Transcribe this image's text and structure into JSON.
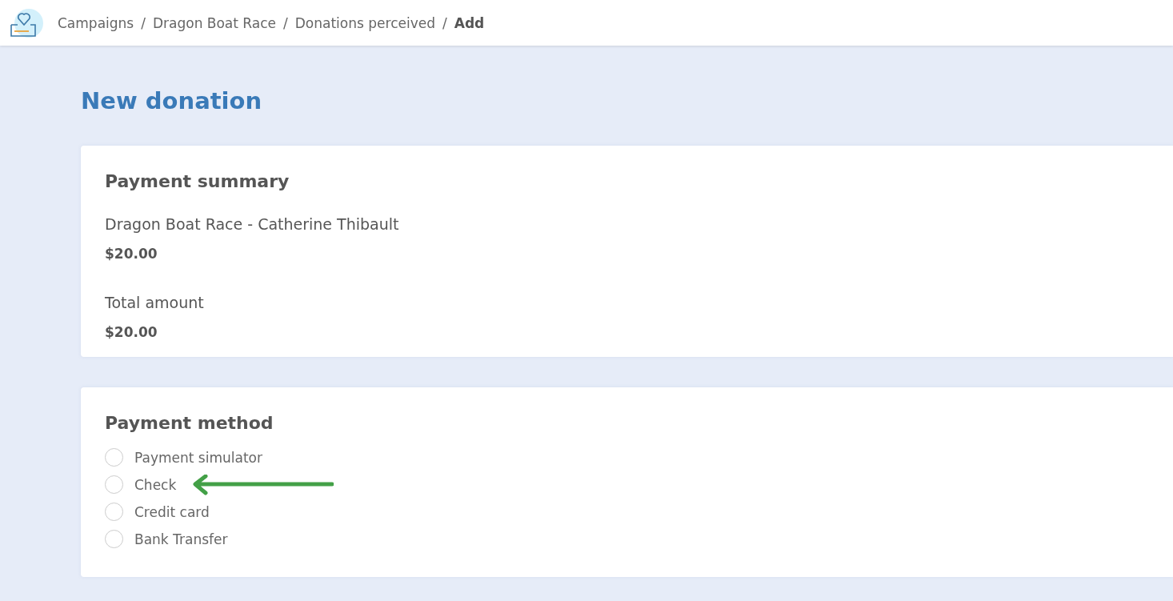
{
  "breadcrumb": [
    {
      "label": "Campaigns",
      "current": false
    },
    {
      "label": "Dragon Boat Race",
      "current": false
    },
    {
      "label": "Donations perceived",
      "current": false
    },
    {
      "label": "Add",
      "current": true
    }
  ],
  "separator": "/",
  "page_title": "New donation",
  "payment_summary": {
    "title": "Payment summary",
    "items": [
      {
        "name": "Dragon Boat Race - Catherine Thibault",
        "amount": "$20.00"
      }
    ],
    "total_label": "Total amount",
    "total": "$20.00"
  },
  "payment_method": {
    "title": "Payment method",
    "options": [
      {
        "label": "Payment simulator",
        "selected": false
      },
      {
        "label": "Check",
        "selected": false,
        "annotated": true
      },
      {
        "label": "Credit card",
        "selected": false
      },
      {
        "label": "Bank Transfer",
        "selected": false
      }
    ]
  }
}
